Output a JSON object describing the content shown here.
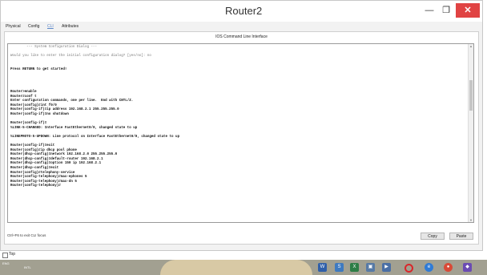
{
  "window": {
    "title": "Router2",
    "minimize_icon": "minimize-icon",
    "maximize_icon": "maximize-icon",
    "close_icon": "close-icon",
    "minimize_glyph": "—",
    "maximize_glyph": "❐",
    "close_glyph": "✕"
  },
  "tabs": [
    {
      "label": "Physical"
    },
    {
      "label": "Config"
    },
    {
      "label": "CLI"
    },
    {
      "label": "Attributes"
    }
  ],
  "panel": {
    "title": "IOS Command Line Interface",
    "hint": "Ctrl+F6 to exit CLI focus",
    "copy_label": "Copy",
    "paste_label": "Paste"
  },
  "terminal": {
    "lines": [
      "        --- System Configuration Dialog ---",
      "",
      "Would you like to enter the initial configuration dialog? [yes/no]: no",
      "",
      "",
      "Press RETURN to get started!",
      "",
      "",
      "",
      "",
      "Router>enable",
      "Router#conf t",
      "Enter configuration commands, one per line.  End with CNTL/Z.",
      "Router(config)#int f0/0",
      "Router(config-if)#ip address 192.168.2.1 255.255.255.0",
      "Router(config-if)#no shutdown",
      "",
      "Router(config-if)#",
      "%LINK-5-CHANGED: Interface FastEthernet0/0, changed state to up",
      "",
      "%LINEPROTO-5-UPDOWN: Line protocol on Interface FastEthernet0/0, changed state to up",
      "",
      "Router(config-if)#exit",
      "Router(config)#ip dhcp pool phone",
      "Router(dhcp-config)#network 192.168.2.0 255.255.255.0",
      "Router(dhcp-config)#default-router 192.168.2.1",
      "Router(dhcp-config)#option 150 ip 192.168.2.1",
      "Router(dhcp-config)#exit",
      "Router(config)#telephony-service",
      "Router(config-telephony)#max-ephones 5",
      "Router(config-telephony)#max-dn 5",
      "Router(config-telephony)#"
    ]
  },
  "scrollbar": {
    "up_glyph": "▲",
    "down_glyph": "▼"
  },
  "footer": {
    "top_label": "Top"
  },
  "taskbar": {
    "ime_text": "ENG",
    "lang_text": "INTL",
    "icons": [
      "word-icon",
      "skype-icon",
      "excel-icon",
      "gallery-icon",
      "video-icon",
      "opera-icon",
      "edge-icon",
      "chrome-icon",
      "app-icon"
    ]
  }
}
